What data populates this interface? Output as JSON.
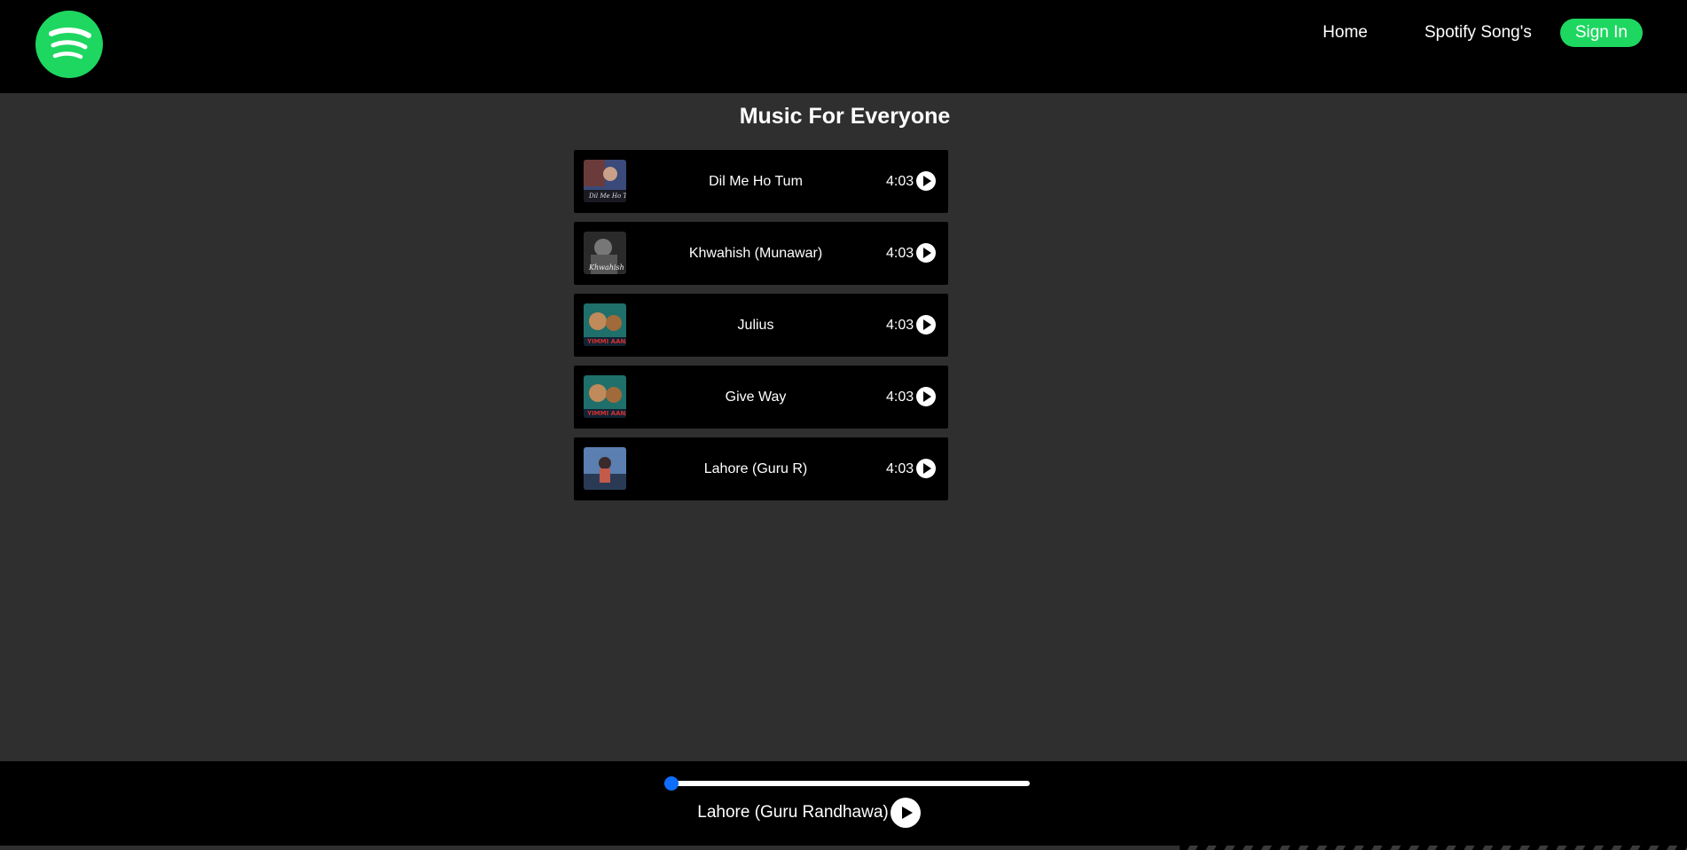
{
  "nav": {
    "logo_icon": "spotify-logo-icon",
    "links": [
      "Home",
      "Spotify Song's"
    ],
    "signin_label": "Sign In",
    "brand_color": "#1ed760"
  },
  "main": {
    "title": "Music For Everyone",
    "songs": [
      {
        "name": "Dil Me Ho Tum",
        "duration": "4:03",
        "cover_colors": [
          "#6b3a3a",
          "#3a4a7a",
          "#c9a08a"
        ]
      },
      {
        "name": "Khwahish (Munawar)",
        "duration": "4:03",
        "cover_colors": [
          "#2a2a2a",
          "#777777",
          "#cfcfcf"
        ]
      },
      {
        "name": "Julius",
        "duration": "4:03",
        "cover_colors": [
          "#1f6f6a",
          "#c08a5a",
          "#d43030"
        ]
      },
      {
        "name": "Give Way",
        "duration": "4:03",
        "cover_colors": [
          "#1f6f6a",
          "#c08a5a",
          "#d43030"
        ]
      },
      {
        "name": "Lahore (Guru R)",
        "duration": "4:03",
        "cover_colors": [
          "#5a7fb0",
          "#2a3a55",
          "#c45a4a"
        ]
      }
    ],
    "play_icon": "play-circle-icon"
  },
  "player": {
    "now_playing": "Lahore (Guru Randhawa)",
    "progress": 0,
    "accent_color": "#0d6efd",
    "play_icon": "play-circle-icon"
  }
}
